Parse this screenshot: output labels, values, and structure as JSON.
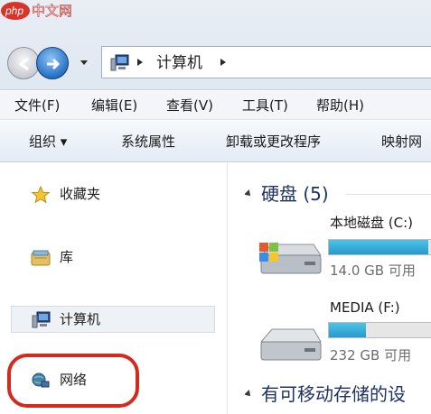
{
  "watermark": {
    "text": "中文网",
    "logo_text": "php"
  },
  "address_bar": {
    "path": [
      "计算机"
    ],
    "icon": "computer-icon"
  },
  "menu": {
    "items": [
      {
        "label": "文件(F)"
      },
      {
        "label": "编辑(E)"
      },
      {
        "label": "查看(V)"
      },
      {
        "label": "工具(T)"
      },
      {
        "label": "帮助(H)"
      }
    ]
  },
  "commands": {
    "items": [
      {
        "label": "组织 ▾"
      },
      {
        "label": "系统属性"
      },
      {
        "label": "卸载或更改程序"
      },
      {
        "label": "映射网"
      }
    ]
  },
  "nav_pane": {
    "items": [
      {
        "label": "收藏夹",
        "icon": "star-icon"
      },
      {
        "label": "库",
        "icon": "library-icon"
      },
      {
        "label": "计算机",
        "icon": "computer-icon",
        "selected": true
      },
      {
        "label": "网络",
        "icon": "network-icon",
        "highlighted": true
      }
    ]
  },
  "content": {
    "groups": [
      {
        "title": "硬盘 (5)"
      },
      {
        "title": "有可移动存储的设"
      }
    ],
    "drives": [
      {
        "name": "本地磁盘 (C:)",
        "free_text": "14.0 GB 可用",
        "used_fraction": 0.93,
        "icon": "windows-drive-icon"
      },
      {
        "name": "MEDIA (F:)",
        "free_text": "232 GB 可用",
        "used_fraction": 0.35,
        "icon": "hard-drive-icon"
      }
    ]
  },
  "colors": {
    "accent": "#2e77c9",
    "bar_fill": "#2898c9",
    "highlight_ring": "#d42a1e",
    "group_title": "#1e3264"
  }
}
